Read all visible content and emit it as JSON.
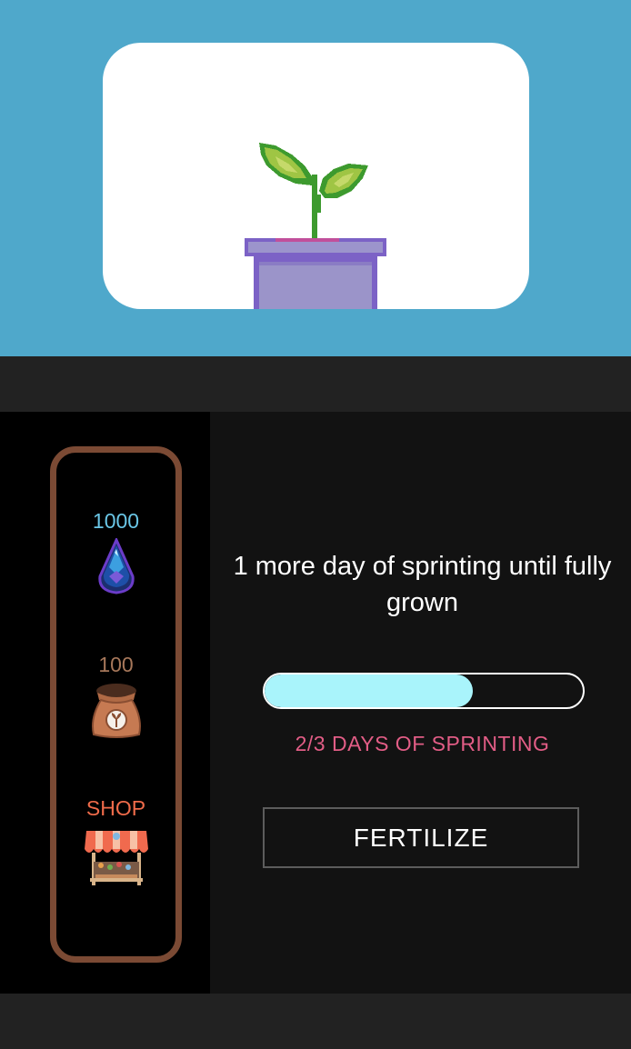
{
  "plant": {
    "icon": "sprout-in-pot-icon"
  },
  "resources": {
    "water": {
      "count": "1000",
      "icon": "water-drop-icon",
      "color": "#6ac6e6"
    },
    "fertilizer": {
      "count": "100",
      "icon": "fertilizer-bag-icon",
      "color": "#a6775a"
    },
    "shop": {
      "label": "SHOP",
      "icon": "market-stall-icon",
      "color": "#ef6b4a"
    }
  },
  "status": {
    "message": "1 more day of sprinting until fully grown"
  },
  "progress": {
    "completed_days": 2,
    "total_days": 3,
    "fraction": 0.655,
    "caption": "2/3 DAYS OF SPRINTING",
    "fill_color": "#a9f4fb"
  },
  "actions": {
    "fertilize_label": "FERTILIZE"
  },
  "colors": {
    "sky": "#4fa8cb",
    "frame": "#7b4a34",
    "caption": "#e25d86"
  }
}
